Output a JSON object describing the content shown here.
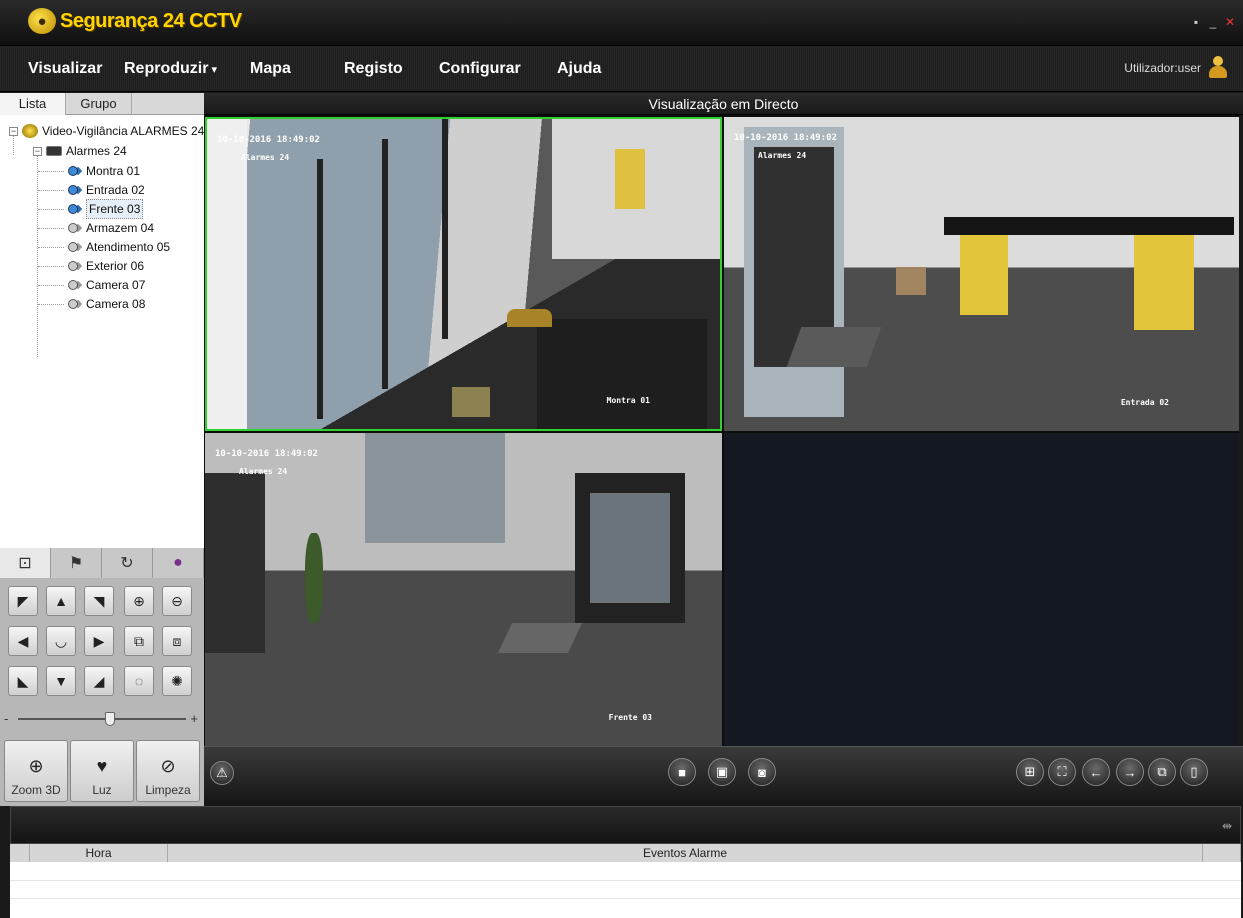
{
  "app": {
    "title": "Segurança 24 CCTV"
  },
  "menu": {
    "items": [
      "Visualizar",
      "Reproduzir",
      "Mapa",
      "Registo",
      "Configurar",
      "Ajuda"
    ],
    "user_label": "Utilizador:user"
  },
  "left_panel": {
    "tabs": [
      "Lista",
      "Grupo"
    ],
    "tree": {
      "root": "Video-Vigilância ALARMES 24",
      "group": "Alarmes 24",
      "cameras": [
        "Montra 01",
        "Entrada 02",
        "Frente 03",
        "Armazem 04",
        "Atendimento 05",
        "Exterior 06",
        "Camera 07",
        "Camera 08"
      ],
      "selected": "Frente 03"
    }
  },
  "ptz": {
    "tabs": [
      "ptz-icon",
      "preset-flag-icon",
      "patrol-icon",
      "color-icon"
    ],
    "big_buttons": [
      "Zoom 3D",
      "Luz",
      "Limpeza"
    ],
    "speed_fraction": 0.55,
    "slider_minus": "-",
    "slider_plus": "+"
  },
  "live": {
    "header": "Visualização em Directo",
    "channels": [
      {
        "timestamp": "10-10-2016 18:49:02",
        "dvr": "Alarmes 24",
        "name": "Montra 01"
      },
      {
        "timestamp": "10-10-2016 18:49:02",
        "dvr": "Alarmes 24",
        "name": "Entrada 02"
      },
      {
        "timestamp": "10-10-2016 18:49:02",
        "dvr": "Alarmes 24",
        "name": "Frente 03"
      },
      {
        "timestamp": "",
        "dvr": "",
        "name": ""
      }
    ],
    "selected_channel": 0,
    "accent_color": "#2fd12f"
  },
  "events": {
    "columns": [
      "Hora",
      "Eventos Alarme"
    ]
  }
}
